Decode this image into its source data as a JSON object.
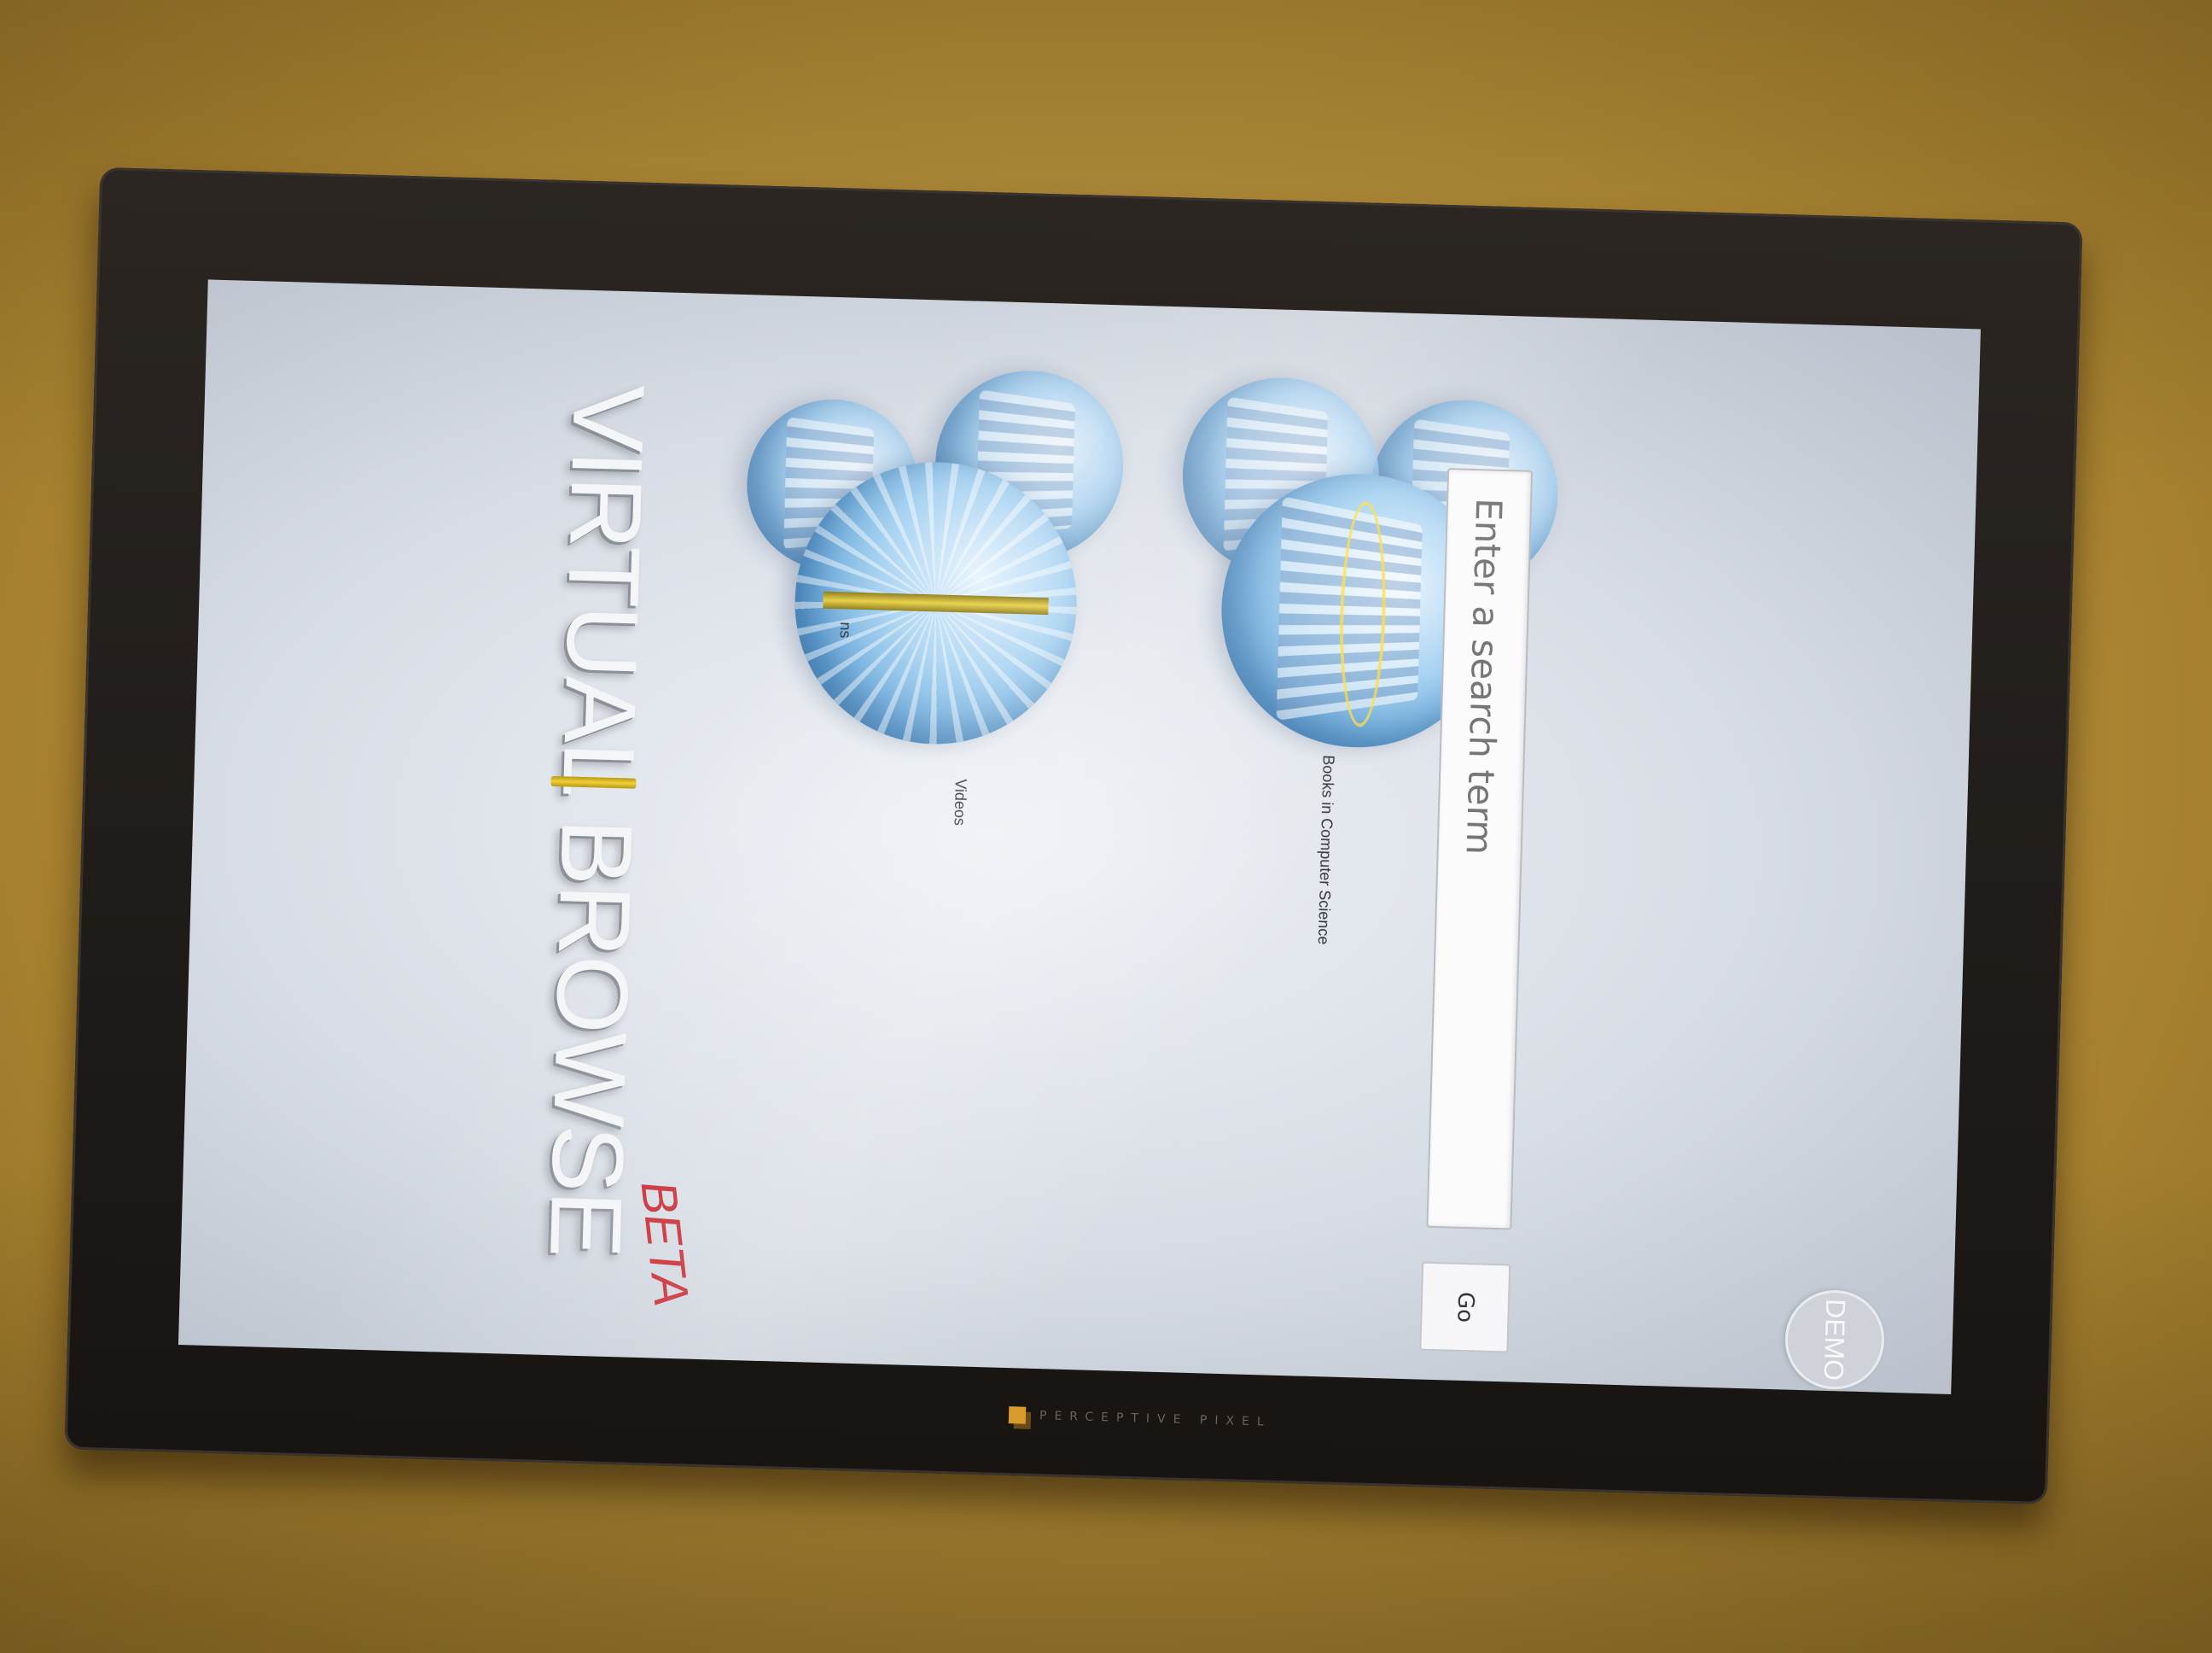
{
  "app": {
    "title": "VIRTUAL BROWSE",
    "badge": "BETA"
  },
  "monitor": {
    "brand": "PERCEPTIVE PIXEL"
  },
  "orbs": [
    {
      "label": "Videos"
    },
    {
      "label": "ns"
    },
    {
      "label": "Books in Computer Science"
    }
  ],
  "search": {
    "placeholder": "Enter a search term",
    "go_label": "Go"
  },
  "demo": {
    "label": "DEMO"
  }
}
